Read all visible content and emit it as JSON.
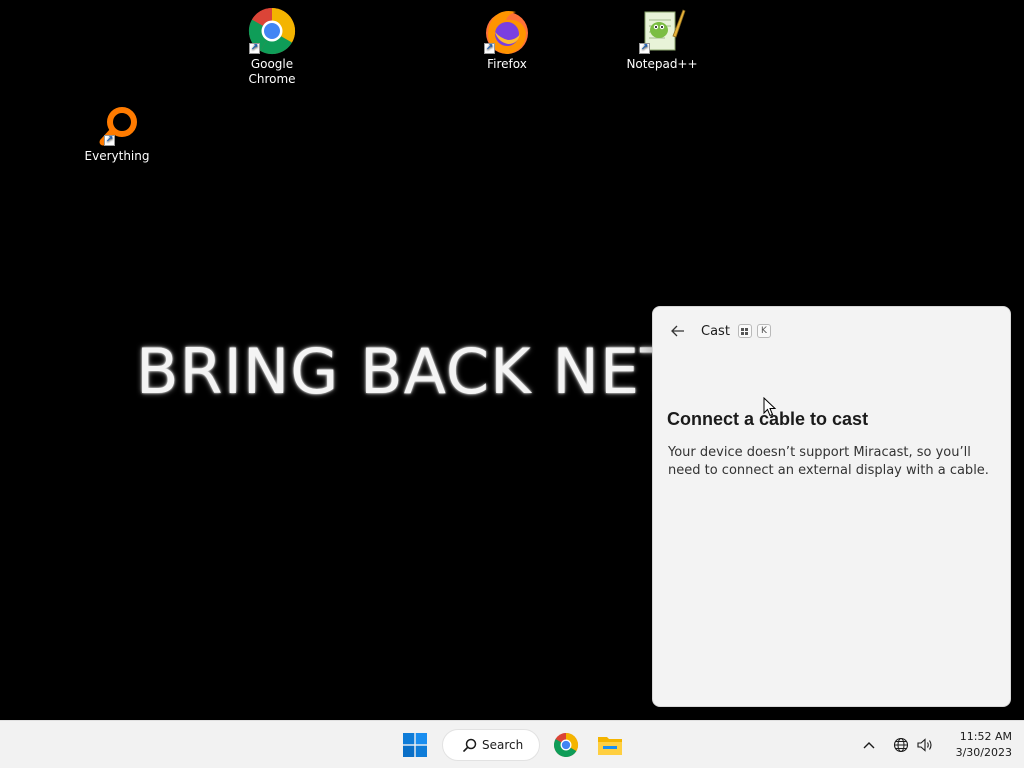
{
  "desktop": {
    "wallpaper_text": "BRING BACK NET",
    "icons": [
      {
        "label": "Google\nChrome",
        "icon": "chrome-icon"
      },
      {
        "label": "Firefox",
        "icon": "firefox-icon"
      },
      {
        "label": "Notepad++",
        "icon": "notepadpp-icon"
      },
      {
        "label": "Everything",
        "icon": "everything-icon"
      }
    ]
  },
  "cast_panel": {
    "title": "Cast",
    "shortcut_key": "K",
    "heading": "Connect a cable to cast",
    "body": "Your device doesn’t support Miracast, so you’ll need to connect an external display with a cable."
  },
  "taskbar": {
    "search_label": "Search",
    "time": "11:52 AM",
    "date": "3/30/2023"
  },
  "colors": {
    "accent": "#0078d4",
    "desktop_bg": "#000000",
    "taskbar_bg": "#f2f2f2",
    "panel_bg": "#f3f3f3"
  }
}
